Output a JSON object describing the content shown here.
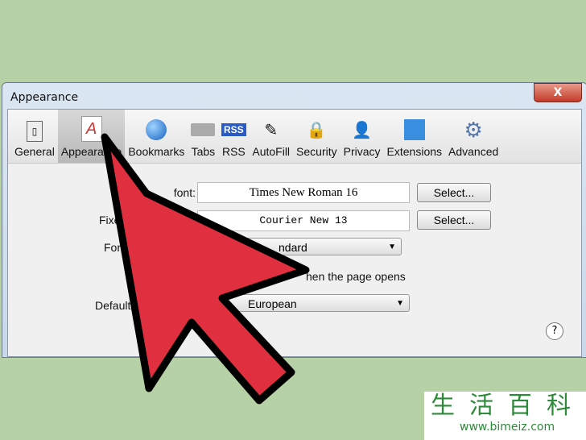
{
  "window": {
    "title": "Appearance",
    "close_label": "X"
  },
  "toolbar": {
    "items": [
      {
        "label": "General",
        "icon": "switch-icon"
      },
      {
        "label": "Appearance",
        "icon": "appearance-icon",
        "selected": true
      },
      {
        "label": "Bookmarks",
        "icon": "globe-icon"
      },
      {
        "label": "Tabs",
        "icon": "tabs-icon"
      },
      {
        "label": "RSS",
        "icon": "rss-icon"
      },
      {
        "label": "AutoFill",
        "icon": "pencil-icon"
      },
      {
        "label": "Security",
        "icon": "lock-icon"
      },
      {
        "label": "Privacy",
        "icon": "person-icon"
      },
      {
        "label": "Extensions",
        "icon": "puzzle-icon"
      },
      {
        "label": "Advanced",
        "icon": "gear-icon"
      }
    ]
  },
  "settings": {
    "standard_font_label": "font:",
    "standard_font_value": "Times New Roman 16",
    "fixed_font_label": "Fixe",
    "fixed_font_value": "Courier New 13",
    "select_label": "Select...",
    "font_smoothing_label": "Fon",
    "font_smoothing_value": "ndard",
    "images_label": "hen the page opens",
    "encoding_label": "Default",
    "encoding_value": "European",
    "help_label": "?"
  },
  "watermark": {
    "chinese": "生活百科",
    "url": "www.bimeiz.com"
  },
  "colors": {
    "arrow": "#e0303f",
    "background": "#b5d1a5"
  }
}
